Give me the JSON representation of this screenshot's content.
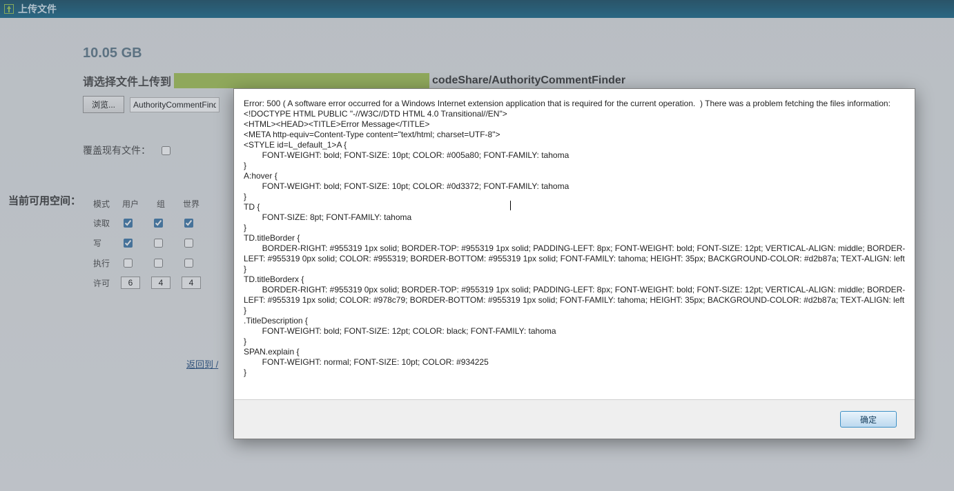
{
  "titlebar": {
    "title": "上传文件"
  },
  "space": {
    "value": "10.05 GB"
  },
  "upload": {
    "prompt_prefix": "请选择文件上传到",
    "path_tail": "codeShare/AuthorityCommentFinder",
    "browse_label": "浏览...",
    "file_value": "AuthorityCommentFinder"
  },
  "overwrite": {
    "label": "覆盖现有文件："
  },
  "side_label": "当前可用空间：",
  "perm": {
    "header": {
      "mode": "模式",
      "user": "用户",
      "group": "组",
      "world": "世界"
    },
    "rows": {
      "read": {
        "label": "读取",
        "user": true,
        "group": true,
        "world": true
      },
      "write": {
        "label": "写",
        "user": true,
        "group": false,
        "world": false
      },
      "exec": {
        "label": "执行",
        "user": false,
        "group": false,
        "world": false
      },
      "perm": {
        "label": "许可",
        "user": "6",
        "group": "4",
        "world": "4"
      }
    }
  },
  "backlink": "返回到 /",
  "dialog": {
    "ok_label": "确定",
    "error_text": "Error: 500 ( A software error occurred for a Windows Internet extension application that is required for the current operation.  ) There was a problem fetching the files information: <!DOCTYPE HTML PUBLIC \"-//W3C//DTD HTML 4.0 Transitional//EN\">\n<HTML><HEAD><TITLE>Error Message</TITLE>\n<META http-equiv=Content-Type content=\"text/html; charset=UTF-8\">\n<STYLE id=L_default_1>A {\n        FONT-WEIGHT: bold; FONT-SIZE: 10pt; COLOR: #005a80; FONT-FAMILY: tahoma\n}\nA:hover {\n        FONT-WEIGHT: bold; FONT-SIZE: 10pt; COLOR: #0d3372; FONT-FAMILY: tahoma\n}\nTD {\n        FONT-SIZE: 8pt; FONT-FAMILY: tahoma\n}\nTD.titleBorder {\n        BORDER-RIGHT: #955319 1px solid; BORDER-TOP: #955319 1px solid; PADDING-LEFT: 8px; FONT-WEIGHT: bold; FONT-SIZE: 12pt; VERTICAL-ALIGN: middle; BORDER-LEFT: #955319 0px solid; COLOR: #955319; BORDER-BOTTOM: #955319 1px solid; FONT-FAMILY: tahoma; HEIGHT: 35px; BACKGROUND-COLOR: #d2b87a; TEXT-ALIGN: left\n}\nTD.titleBorderx {\n        BORDER-RIGHT: #955319 0px solid; BORDER-TOP: #955319 1px solid; PADDING-LEFT: 8px; FONT-WEIGHT: bold; FONT-SIZE: 12pt; VERTICAL-ALIGN: middle; BORDER-LEFT: #955319 1px solid; COLOR: #978c79; BORDER-BOTTOM: #955319 1px solid; FONT-FAMILY: tahoma; HEIGHT: 35px; BACKGROUND-COLOR: #d2b87a; TEXT-ALIGN: left\n}\n.TitleDescription {\n        FONT-WEIGHT: bold; FONT-SIZE: 12pt; COLOR: black; FONT-FAMILY: tahoma\n}\nSPAN.explain {\n        FONT-WEIGHT: normal; FONT-SIZE: 10pt; COLOR: #934225\n}"
  }
}
